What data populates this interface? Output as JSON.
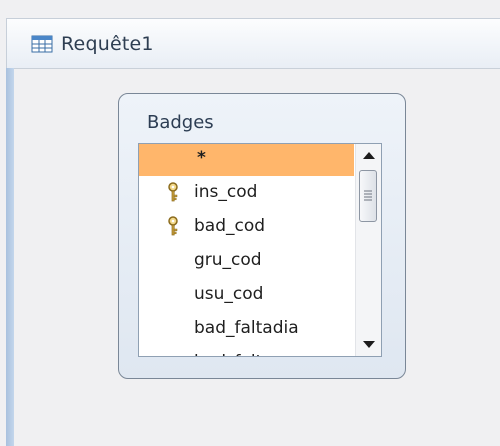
{
  "window": {
    "title": "Requête1",
    "icon": "query-icon"
  },
  "table": {
    "title": "Badges",
    "fields": [
      {
        "label": "*",
        "selected": true,
        "primary_key": false
      },
      {
        "label": "ins_cod",
        "selected": false,
        "primary_key": true
      },
      {
        "label": "bad_cod",
        "selected": false,
        "primary_key": true
      },
      {
        "label": "gru_cod",
        "selected": false,
        "primary_key": false
      },
      {
        "label": "usu_cod",
        "selected": false,
        "primary_key": false
      },
      {
        "label": "bad_faltadia",
        "selected": false,
        "primary_key": false
      },
      {
        "label": "bad_faltames",
        "selected": false,
        "primary_key": false
      }
    ]
  },
  "colors": {
    "selection": "#ffb66b",
    "title_text": "#2e3e52",
    "accent_bar": "#b7cde6"
  }
}
